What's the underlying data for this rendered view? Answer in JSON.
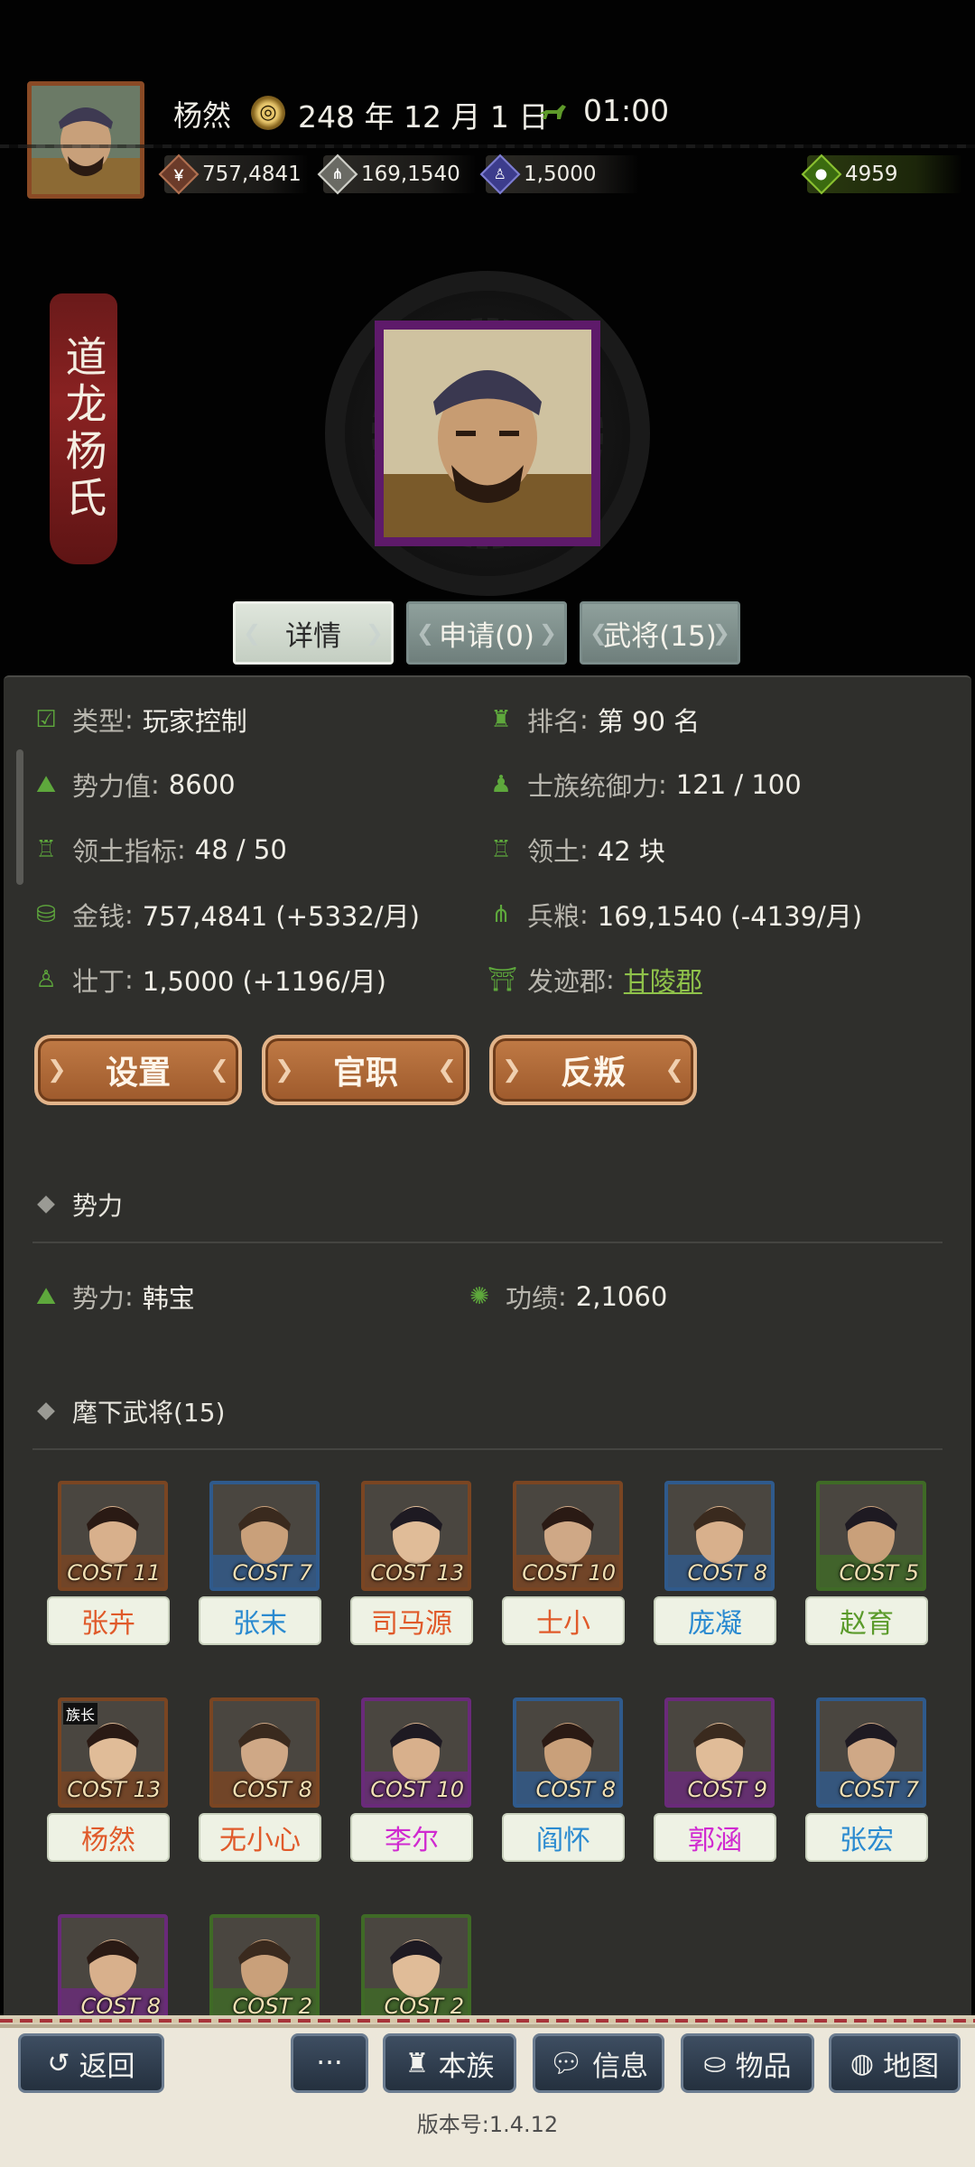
{
  "header": {
    "player_name": "杨然",
    "date": "248 年 12 月 1 日",
    "time": "01:00",
    "resources": {
      "money": "757,4841",
      "food": "169,1540",
      "manpower": "1,5000",
      "gold": "4959"
    }
  },
  "hero": {
    "clan_title_chars": "道龙杨氏"
  },
  "tabs": {
    "details": "详情",
    "applications": "申请(0)",
    "generals": "武将(15)"
  },
  "info": {
    "type_label": "类型",
    "type_value": "玩家控制",
    "rank_label": "排名",
    "rank_value": "第 90 名",
    "power_label": "势力值",
    "power_value": "8600",
    "clan_control_label": "士族统御力",
    "clan_control_value": "121 / 100",
    "territory_index_label": "领土指标",
    "territory_index_value": "48 / 50",
    "territory_label": "领土",
    "territory_value": "42 块",
    "money_label": "金钱",
    "money_value": "757,4841 (+5332/月)",
    "food_label": "兵粮",
    "food_value": "169,1540 (-4139/月)",
    "manpower_label": "壮丁",
    "manpower_value": "1,5000 (+1196/月)",
    "origin_label": "发迹郡",
    "origin_value": "甘陵郡"
  },
  "actions": {
    "settings": "设置",
    "office": "官职",
    "rebel": "反叛"
  },
  "faction_section": {
    "title": "势力",
    "faction_label": "势力",
    "faction_value": "韩宝",
    "merit_label": "功绩",
    "merit_value": "2,1060"
  },
  "generals_section": {
    "title": "麾下武将(15)",
    "leader_tag": "族长",
    "generals": [
      {
        "name": "张卉",
        "cost": "11",
        "name_color": "#e05a2a",
        "frame_color": "#7a4522"
      },
      {
        "name": "张末",
        "cost": "7",
        "name_color": "#2a8ad0",
        "frame_color": "#2f5a8c"
      },
      {
        "name": "司马源",
        "cost": "13",
        "name_color": "#e05a2a",
        "frame_color": "#7a4522"
      },
      {
        "name": "士小",
        "cost": "10",
        "name_color": "#e05a2a",
        "frame_color": "#7a4522"
      },
      {
        "name": "庞凝",
        "cost": "8",
        "name_color": "#2a8ad0",
        "frame_color": "#2f5a8c"
      },
      {
        "name": "赵育",
        "cost": "5",
        "name_color": "#5a9a2a",
        "frame_color": "#3f6a26"
      },
      {
        "name": "杨然",
        "cost": "13",
        "name_color": "#e05a2a",
        "frame_color": "#7a4522"
      },
      {
        "name": "无小心",
        "cost": "8",
        "name_color": "#e05a2a",
        "frame_color": "#7a4522"
      },
      {
        "name": "李尔",
        "cost": "10",
        "name_color": "#d02ad0",
        "frame_color": "#6a2a7a"
      },
      {
        "name": "阎怀",
        "cost": "8",
        "name_color": "#2a8ad0",
        "frame_color": "#2f5a8c"
      },
      {
        "name": "郭涵",
        "cost": "9",
        "name_color": "#d02ad0",
        "frame_color": "#6a2a7a"
      },
      {
        "name": "张宏",
        "cost": "7",
        "name_color": "#2a8ad0",
        "frame_color": "#2f5a8c"
      },
      {
        "name": "",
        "cost": "8",
        "name_color": "#d02ad0",
        "frame_color": "#6a2a7a"
      },
      {
        "name": "",
        "cost": "2",
        "name_color": "#5a9a2a",
        "frame_color": "#3f6a26"
      },
      {
        "name": "",
        "cost": "2",
        "name_color": "#5a9a2a",
        "frame_color": "#3f6a26"
      }
    ]
  },
  "nav": {
    "back": "返回",
    "more": "···",
    "clan": "本族",
    "info": "信息",
    "items": "物品",
    "map": "地图"
  },
  "version": "版本号:1.4.12",
  "icons": {
    "date": "date-coin-icon",
    "time": "horse-icon",
    "money": "coins-icon",
    "food": "grain-icon",
    "manpower": "worker-icon",
    "gold": "money-bag-icon"
  }
}
